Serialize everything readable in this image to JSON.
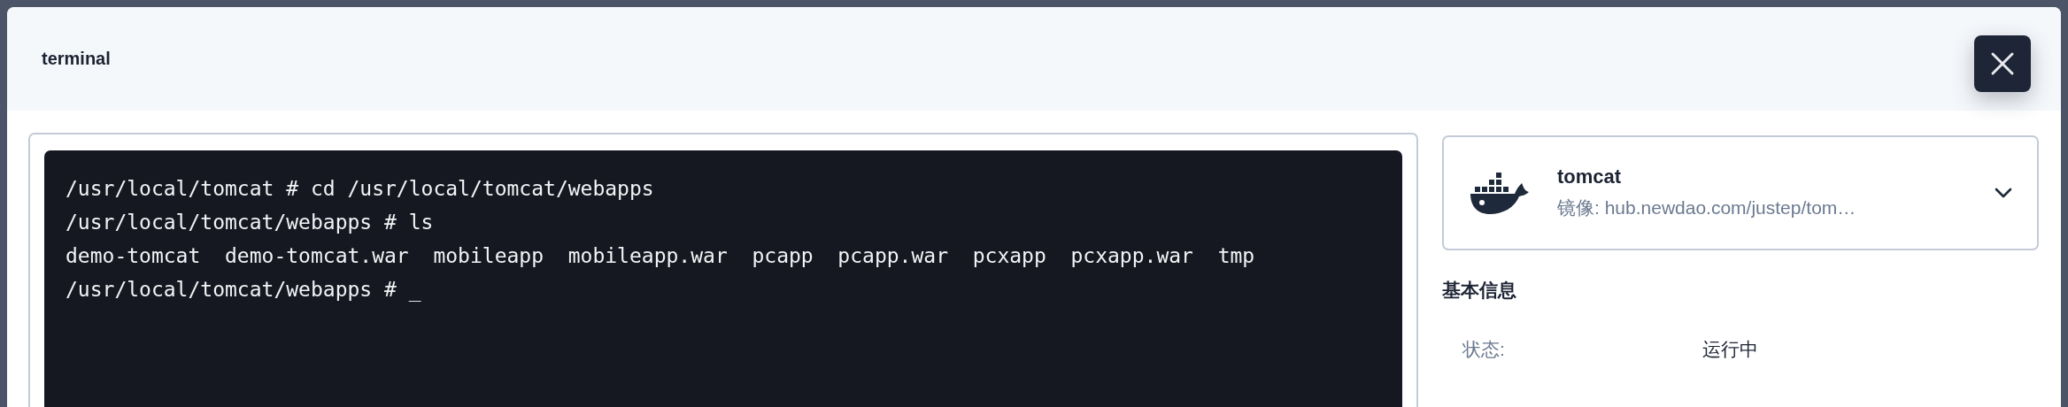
{
  "dialog": {
    "title": "terminal"
  },
  "terminal": {
    "lines": [
      "/usr/local/tomcat # cd /usr/local/tomcat/webapps",
      "/usr/local/tomcat/webapps # ls",
      "demo-tomcat  demo-tomcat.war  mobileapp  mobileapp.war  pcapp  pcapp.war  pcxapp  pcxapp.war  tmp",
      "/usr/local/tomcat/webapps # _"
    ]
  },
  "image_card": {
    "name": "tomcat",
    "subtitle": "镜像: hub.newdao.com/justep/tom…",
    "expanded": false
  },
  "basic_info": {
    "heading": "基本信息",
    "rows": [
      {
        "label": "状态:",
        "value": "运行中"
      }
    ]
  }
}
